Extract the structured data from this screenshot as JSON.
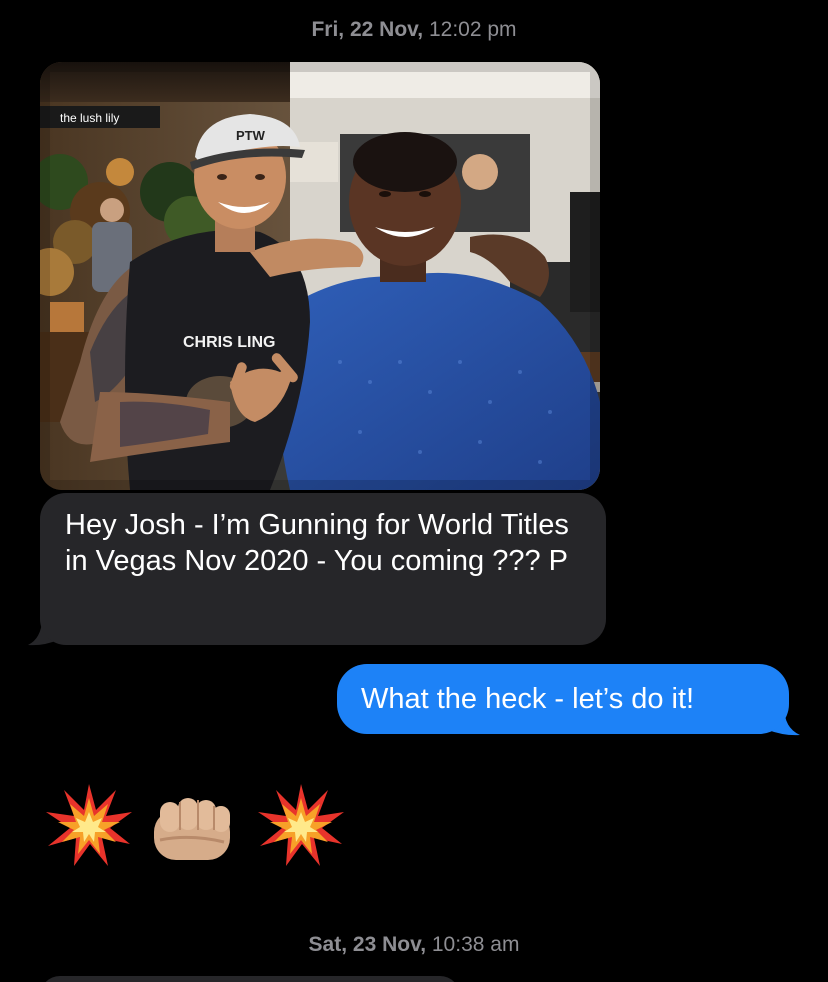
{
  "thread": {
    "timestamp_1_day": "Fri, 22 Nov,",
    "timestamp_1_time": " 12:02 pm",
    "timestamp_2_day": "Sat, 23 Nov,",
    "timestamp_2_time": " 10:38 am"
  },
  "messages": [
    {
      "type": "photo",
      "direction": "incoming",
      "shop_sign": "the lush lily",
      "cap_text": "PTW",
      "shirt_text": "CHRIS LING"
    },
    {
      "type": "text",
      "direction": "incoming",
      "text": "Hey Josh - I’m Gunning for World Titles in Vegas Nov 2020 - You coming ??? P"
    },
    {
      "type": "text",
      "direction": "outgoing",
      "text": "What the heck - let’s do it!"
    },
    {
      "type": "emoji",
      "direction": "incoming",
      "emojis": [
        "collision-icon",
        "fist-bump-icon",
        "collision-icon"
      ]
    }
  ],
  "colors": {
    "background": "#000000",
    "incoming_bubble": "#262629",
    "outgoing_bubble": "#1d82f7",
    "timestamp": "#8e8e93"
  }
}
